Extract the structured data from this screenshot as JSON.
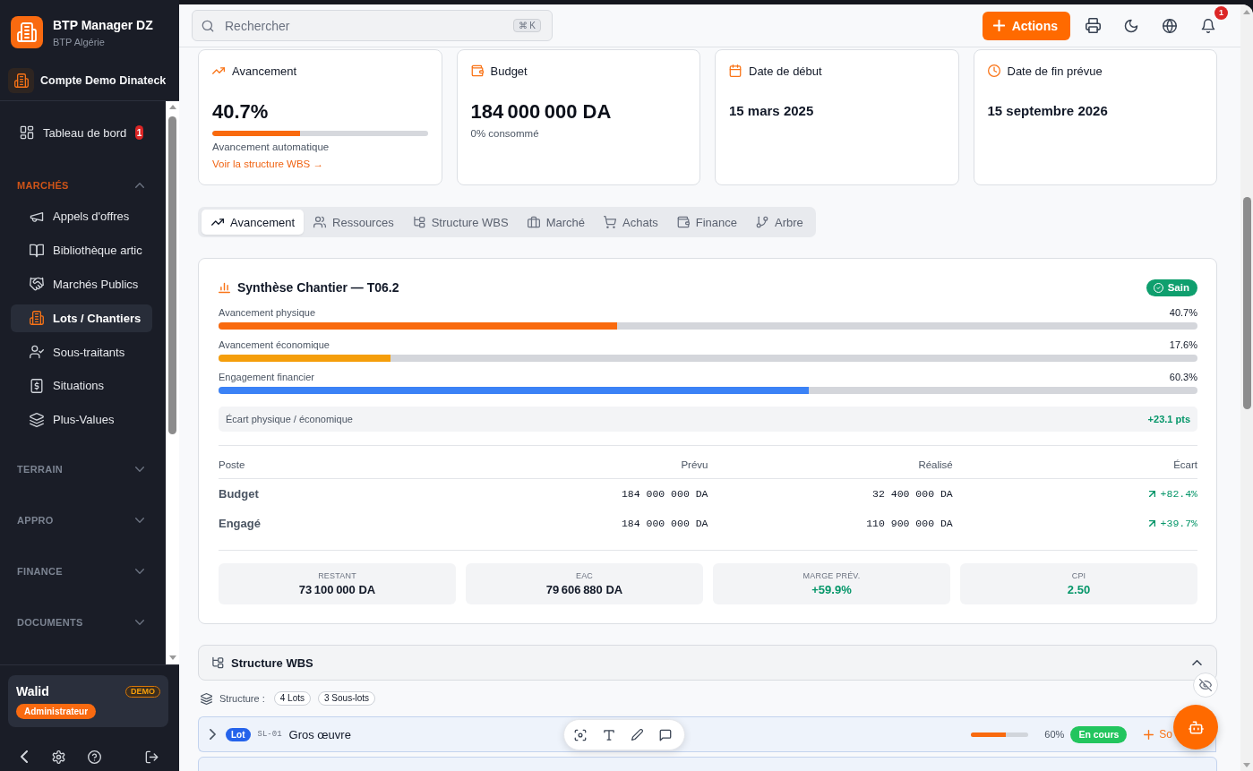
{
  "sidebar": {
    "app_title": "BTP Manager DZ",
    "app_subtitle": "BTP Algérie",
    "account": "Compte Demo Dinateck",
    "items": [
      {
        "label": "Tableau de bord",
        "badge": "1",
        "selected": false
      }
    ],
    "sections": [
      {
        "title": "MARCHÉS",
        "expanded": true,
        "items": [
          {
            "label": "Appels d'offres",
            "selected": false
          },
          {
            "label": "Bibliothèque artic",
            "selected": false
          },
          {
            "label": "Marchés Publics",
            "selected": false
          },
          {
            "label": "Lots / Chantiers",
            "selected": true
          },
          {
            "label": "Sous-traitants",
            "selected": false
          },
          {
            "label": "Situations",
            "selected": false
          },
          {
            "label": "Plus-Values",
            "selected": false
          }
        ]
      },
      {
        "title": "TERRAIN",
        "expanded": false
      },
      {
        "title": "APPRO",
        "expanded": false
      },
      {
        "title": "FINANCE",
        "expanded": false
      },
      {
        "title": "DOCUMENTS",
        "expanded": false
      }
    ],
    "user": {
      "name": "Walid",
      "badge": "DEMO",
      "role": "Administrateur"
    }
  },
  "topbar": {
    "search": {
      "placeholder": "Rechercher",
      "shortcut": "⌘ K"
    },
    "actions": "Actions",
    "notification_count": "1"
  },
  "kpi_cards": [
    {
      "kind": "progress",
      "title": "Avancement",
      "value": "40.7%",
      "level": 0.407,
      "caption": "Avancement automatique",
      "link": "Voir la structure WBS →"
    },
    {
      "kind": "amount",
      "title": "Budget",
      "value": "184 000 000 DA",
      "caption": "0% consommé"
    },
    {
      "kind": "date",
      "title": "Date de début",
      "value": "15 mars 2025"
    },
    {
      "kind": "deadline",
      "title": "Date de fin prévue",
      "value": "15 septembre 2026"
    }
  ],
  "tabs": [
    {
      "label": "Avancement",
      "selected": true
    },
    {
      "label": "Ressources",
      "selected": false
    },
    {
      "label": "Structure WBS",
      "selected": false
    },
    {
      "label": "Marché",
      "selected": false
    },
    {
      "label": "Achats",
      "selected": false
    },
    {
      "label": "Finance",
      "selected": false
    },
    {
      "label": "Arbre",
      "selected": false
    }
  ],
  "synthesis": {
    "title": "Synthèse Chantier — T06.2",
    "status": "Sain",
    "bars": [
      {
        "label": "Avancement physique",
        "reading": "40.7%",
        "level": 0.407,
        "color": "#f96a0e"
      },
      {
        "label": "Avancement économique",
        "reading": "17.6%",
        "level": 0.176,
        "color": "#f59e0b"
      },
      {
        "label": "Engagement financier",
        "reading": "60.3%",
        "level": 0.603,
        "color": "#3b82f6"
      }
    ],
    "gap": {
      "label": "Écart physique / économique",
      "value": "+23.1 pts"
    },
    "table": {
      "columns": [
        "Poste",
        "Prévu",
        "Réalisé",
        "Écart"
      ],
      "rows": [
        {
          "cells": [
            "Budget",
            "184 000 000 DA",
            "32 400 000 DA",
            "+82.4%"
          ],
          "rising": true
        },
        {
          "cells": [
            "Engagé",
            "184 000 000 DA",
            "110 900 000 DA",
            "+39.7%"
          ],
          "rising": true
        }
      ]
    },
    "stats": [
      {
        "label": "RESTANT",
        "value": "73 100 000 DA",
        "positive": false
      },
      {
        "label": "EAC",
        "value": "79 606 880 DA",
        "positive": false
      },
      {
        "label": "MARGE PRÉV.",
        "value": "+59.9%",
        "positive": true
      },
      {
        "label": "CPI",
        "value": "2.50",
        "positive": true
      }
    ]
  },
  "wbs": {
    "title": "Structure WBS",
    "expanded": true,
    "summary_label": "Structure :",
    "chips": [
      "4 Lots",
      "3 Sous-lots"
    ],
    "rows": [
      {
        "type": "Lot",
        "code": "SL-01",
        "name": "Gros œuvre",
        "expanded": false,
        "level": 0.6,
        "reading": "60%",
        "status": "En cours",
        "action": "So"
      }
    ]
  }
}
